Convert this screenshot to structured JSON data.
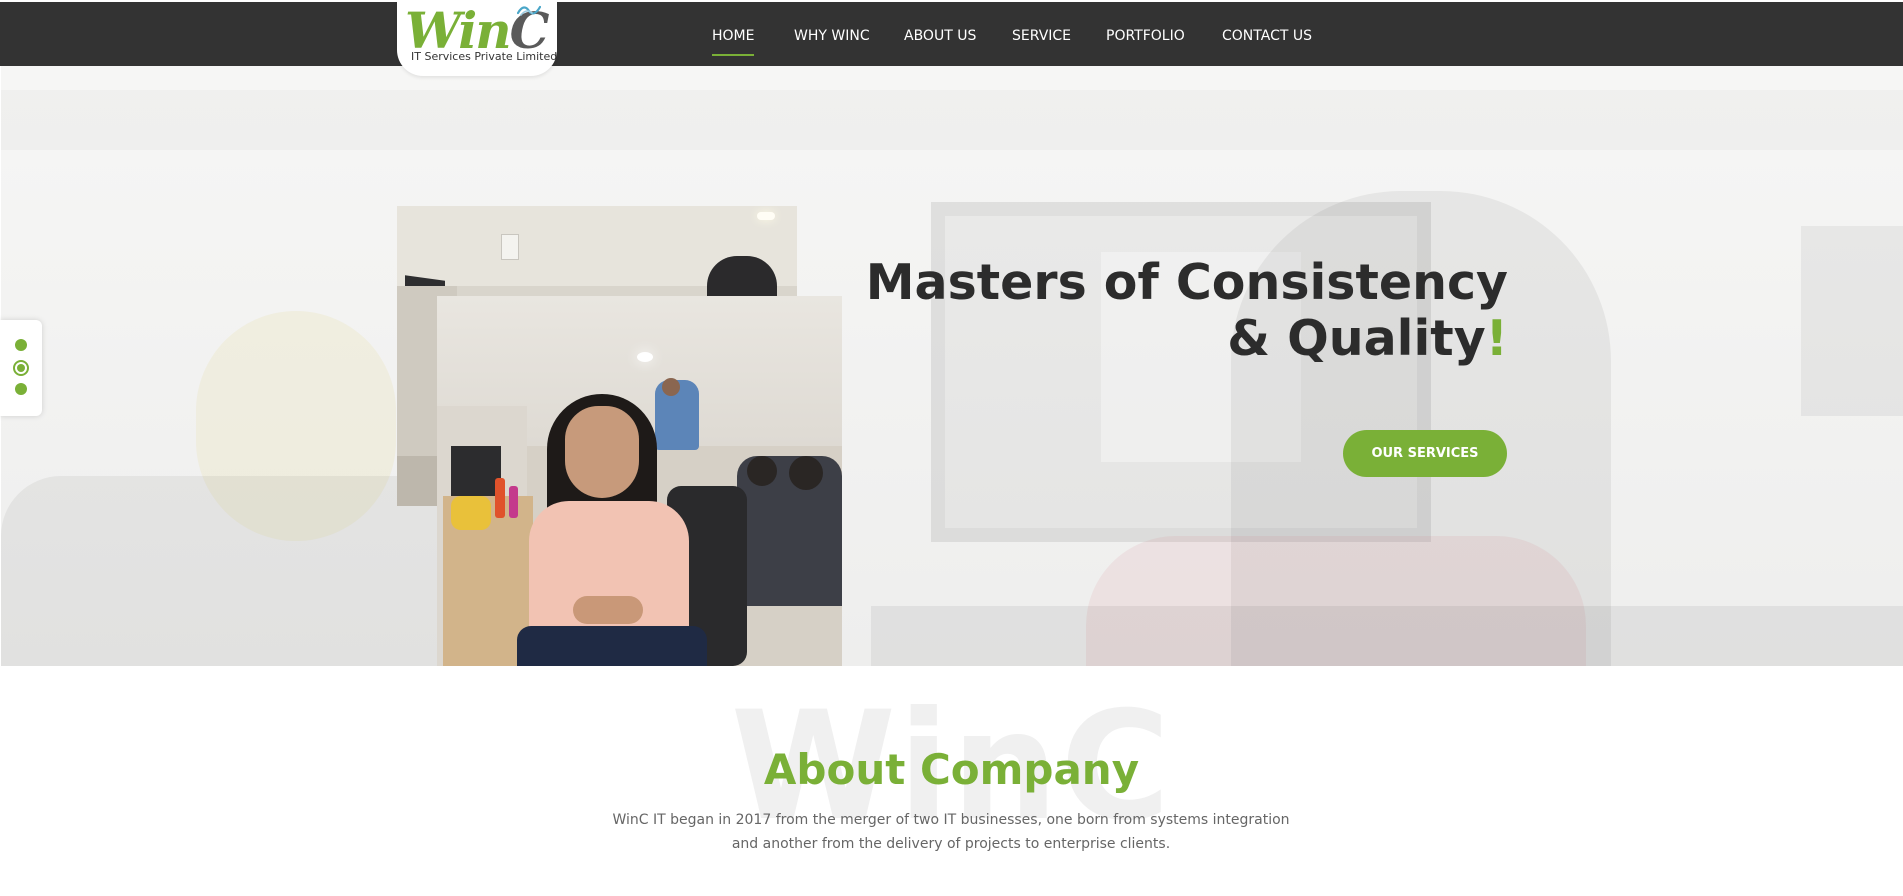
{
  "brand": {
    "logo_word": "Win",
    "logo_word_end": "C",
    "logo_subtitle": "IT Services Private Limited"
  },
  "nav": {
    "items": [
      {
        "label": "HOME",
        "active": true
      },
      {
        "label": "WHY WINC"
      },
      {
        "label": "ABOUT US"
      },
      {
        "label": "SERVICE"
      },
      {
        "label": "PORTFOLIO"
      },
      {
        "label": "CONTACT US"
      }
    ]
  },
  "hero": {
    "title_line1": "Masters of Consistency",
    "title_line2": "& Quality",
    "title_bang": "!",
    "cta_label": "OUR SERVICES"
  },
  "slider": {
    "total_slides": 3,
    "active_slide": 2
  },
  "about": {
    "watermark": "WinC",
    "title": "About Company",
    "text": "WinC IT began in 2017 from the merger of two IT businesses, one born from systems integration and another from the delivery of projects to enterprise clients."
  },
  "colors": {
    "accent": "#7ab037",
    "header_bg": "#333333",
    "heading_dark": "#2c2c2c",
    "body_text": "#666666"
  },
  "icons": {
    "slider_dot": "circle-dot-icon",
    "logo_swoosh": "wave-icon"
  }
}
